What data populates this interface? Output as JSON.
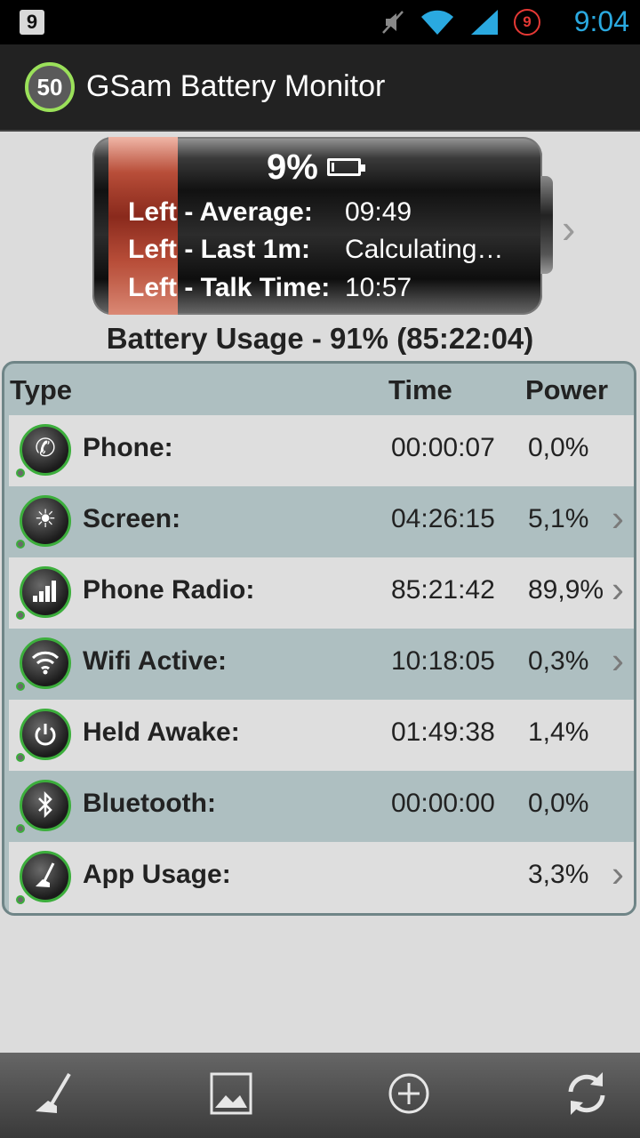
{
  "status_bar": {
    "notification_badge": "9",
    "alarm_badge": "9",
    "clock": "9:04",
    "icons": [
      "mute-icon",
      "wifi-icon",
      "cell-signal-icon",
      "alarm-icon"
    ]
  },
  "app": {
    "logo_text": "50",
    "title": "GSam Battery Monitor"
  },
  "battery": {
    "percent": "9%",
    "level": 0.09,
    "rows": [
      {
        "label": "Left - Average:",
        "value": "09:49"
      },
      {
        "label": "Left - Last 1m:",
        "value": "Calculating…"
      },
      {
        "label": "Left - Talk Time:",
        "value": "10:57"
      }
    ]
  },
  "usage_title": "Battery Usage - 91% (85:22:04)",
  "table": {
    "headers": {
      "type": "Type",
      "time": "Time",
      "power": "Power"
    },
    "rows": [
      {
        "label": "Phone:",
        "time": "00:00:07",
        "power": "0,0%",
        "icon": "phone-icon",
        "chevron": false
      },
      {
        "label": "Screen:",
        "time": "04:26:15",
        "power": "5,1%",
        "icon": "screen-brightness-icon",
        "chevron": true
      },
      {
        "label": "Phone Radio:",
        "time": "85:21:42",
        "power": "89,9%",
        "icon": "signal-bars-icon",
        "chevron": true
      },
      {
        "label": "Wifi Active:",
        "time": "10:18:05",
        "power": "0,3%",
        "icon": "wifi-icon",
        "chevron": true
      },
      {
        "label": "Held Awake:",
        "time": "01:49:38",
        "power": "1,4%",
        "icon": "power-icon",
        "chevron": false
      },
      {
        "label": "Bluetooth:",
        "time": "00:00:00",
        "power": "0,0%",
        "icon": "bluetooth-icon",
        "chevron": false
      },
      {
        "label": "App Usage:",
        "time": "",
        "power": "3,3%",
        "icon": "broom-icon",
        "chevron": true
      }
    ]
  },
  "bottom_bar": [
    "broom-icon",
    "image-icon",
    "add-icon",
    "refresh-icon"
  ],
  "colors": {
    "accent_green": "#3cae3c",
    "clock_blue": "#2aa9e0",
    "row_alt": "#aebfc1"
  }
}
